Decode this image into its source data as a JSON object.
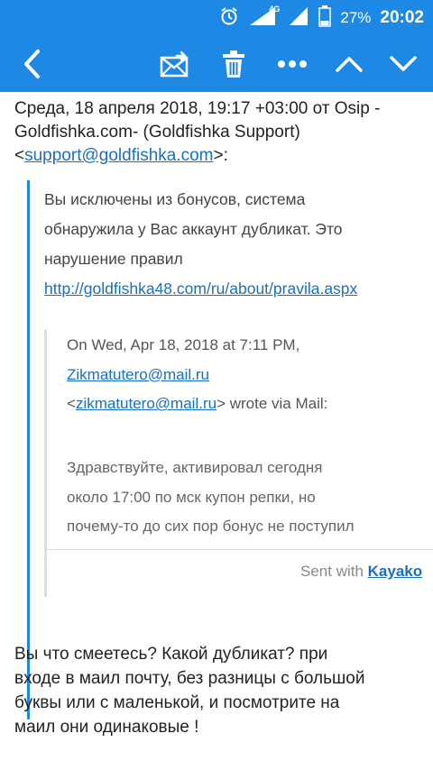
{
  "status": {
    "battery": "27%",
    "time": "20:02",
    "network": "4G"
  },
  "appbar": {
    "icons": [
      "back-icon",
      "move-mail-icon",
      "trash-icon",
      "more-icon",
      "previous-icon",
      "next-icon"
    ]
  },
  "email": {
    "header_line1": "Среда, 18 апреля 2018, 19:17 +03:00 от Osip -",
    "header_line2": "Goldfishka.com- (Goldfishka Support)",
    "header_prefix": "<",
    "header_email": "support@goldfishka.com",
    "header_suffix": ">:",
    "quote_text_1": "Вы исключены из бонусов, система",
    "quote_text_2": "обнаружила у Вас  аккаунт дубликат. Это",
    "quote_text_3": "нарушение правил",
    "quote_link": "http://goldfishka48.com/ru/about/pravila.aspx",
    "nested": {
      "line1": "On Wed, Apr 18, 2018 at 7:11 PM,",
      "sender_link": "Zikmatutero@mail.ru",
      "line3_prefix": "<",
      "line3_email": "zikmatutero@mail.ru",
      "line3_suffix": "> wrote via Mail:",
      "body1": "Здравствуйте, активировал сегодня",
      "body2": "около 17:00 по мск купон репки, но",
      "body3": "почему-то до сих пор бонус не поступил"
    },
    "sent_prefix": "Sent with ",
    "sent_brand": "Kayako",
    "reply_1": "Вы что смеетесь? Какой дубликат? при",
    "reply_2": "входе в маил почту, без разницы с большой",
    "reply_3": "буквы или с маленькой, и посмотрите на",
    "reply_4": "маил они одинаковые !"
  }
}
